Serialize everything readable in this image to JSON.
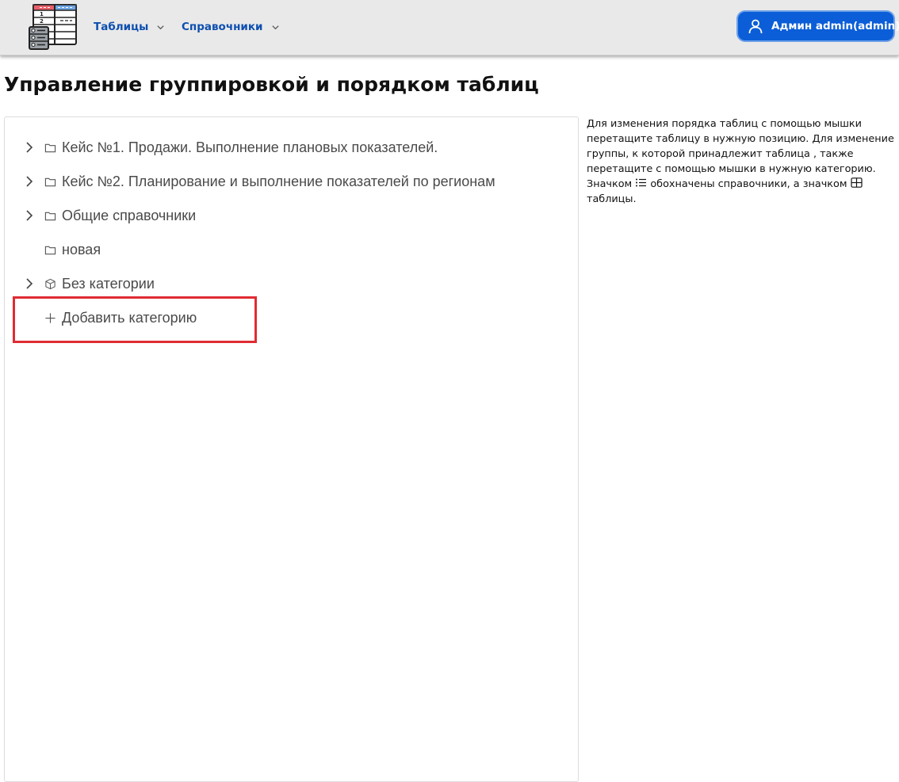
{
  "nav": {
    "menu": [
      {
        "label": "Таблицы"
      },
      {
        "label": "Справочники"
      }
    ],
    "user": {
      "label": "Админ admin(admin)"
    }
  },
  "page": {
    "title": "Управление группировкой и порядком таблиц"
  },
  "tree": {
    "items": [
      {
        "label": "Кейс №1. Продажи. Выполнение плановых показателей.",
        "icon": "folder-icon",
        "expandable": true
      },
      {
        "label": "Кейс №2. Планирование и выполнение показателей по регионам",
        "icon": "folder-icon",
        "expandable": true
      },
      {
        "label": "Общие справочники",
        "icon": "folder-icon",
        "expandable": true
      },
      {
        "label": "новая",
        "icon": "folder-icon",
        "expandable": false
      },
      {
        "label": "Без категории",
        "icon": "box-icon",
        "expandable": true
      }
    ],
    "add_label": "Добавить категорию"
  },
  "help": {
    "part1": "Для изменения порядка таблиц с помощью мышки перетащите таблицу в нужную позицию. Для изменение группы, к которой принадлежит таблица , также перетащите с помощью мышки в нужную категорию. Значком",
    "part2": "обохначены справочники, а значком",
    "part3": "таблицы."
  },
  "colors": {
    "accent": "#0b5ed7",
    "nav_link": "#0d4fb0",
    "highlight": "#e02b33"
  }
}
